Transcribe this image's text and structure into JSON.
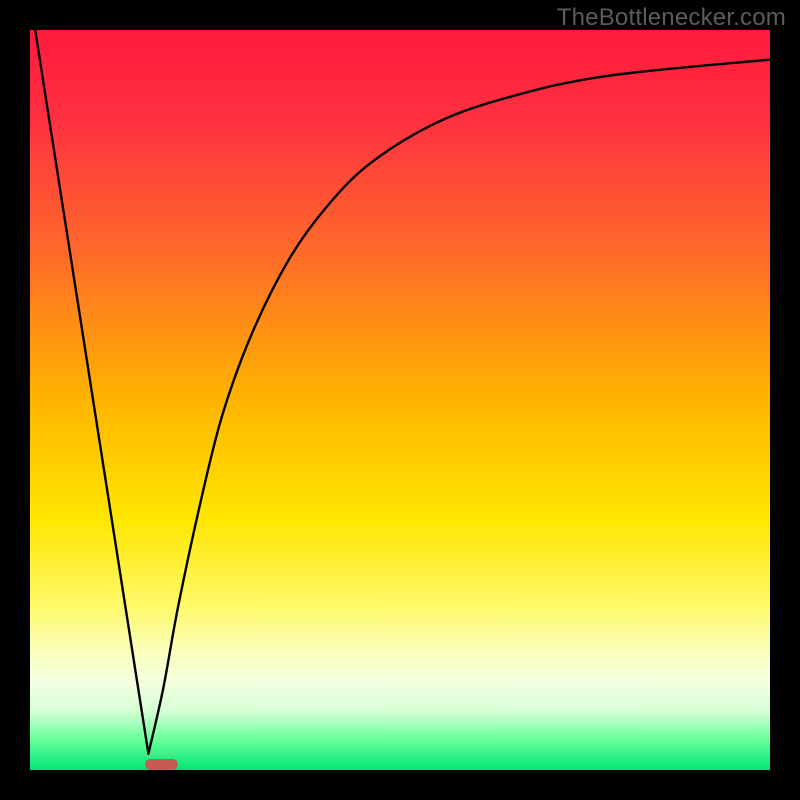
{
  "watermark": "TheBottlenecker.com",
  "chart_data": {
    "type": "line",
    "title": "",
    "xlabel": "",
    "ylabel": "",
    "xlim": [
      0,
      100
    ],
    "ylim": [
      0,
      100
    ],
    "optimum_x": 16,
    "marker": {
      "x_pct": 15.5,
      "width_pct": 4.5,
      "color": "#c85a54"
    },
    "gradient_stops": [
      {
        "pct": 0,
        "color": "#ff1a3c"
      },
      {
        "pct": 12,
        "color": "#ff3040"
      },
      {
        "pct": 30,
        "color": "#ff6a2a"
      },
      {
        "pct": 50,
        "color": "#ffb400"
      },
      {
        "pct": 66,
        "color": "#ffe600"
      },
      {
        "pct": 78,
        "color": "#fff96a"
      },
      {
        "pct": 83,
        "color": "#fbffb0"
      },
      {
        "pct": 88,
        "color": "#f4ffe0"
      },
      {
        "pct": 92,
        "color": "#d6ffd6"
      },
      {
        "pct": 96,
        "color": "#66ff99"
      },
      {
        "pct": 100,
        "color": "#00e676"
      }
    ],
    "series": [
      {
        "name": "left-limb",
        "type": "line",
        "points": [
          {
            "x": 0.7,
            "y": 100
          },
          {
            "x": 16.0,
            "y": 2.2
          }
        ]
      },
      {
        "name": "right-limb",
        "type": "line",
        "points": [
          {
            "x": 16.0,
            "y": 2.2
          },
          {
            "x": 18.0,
            "y": 11
          },
          {
            "x": 20.0,
            "y": 22
          },
          {
            "x": 23.0,
            "y": 36
          },
          {
            "x": 26.0,
            "y": 48
          },
          {
            "x": 30.0,
            "y": 59
          },
          {
            "x": 35.0,
            "y": 69
          },
          {
            "x": 40.0,
            "y": 76
          },
          {
            "x": 46.0,
            "y": 82
          },
          {
            "x": 55.0,
            "y": 87.5
          },
          {
            "x": 65.0,
            "y": 91
          },
          {
            "x": 78.0,
            "y": 93.8
          },
          {
            "x": 100.0,
            "y": 96
          }
        ]
      }
    ]
  }
}
